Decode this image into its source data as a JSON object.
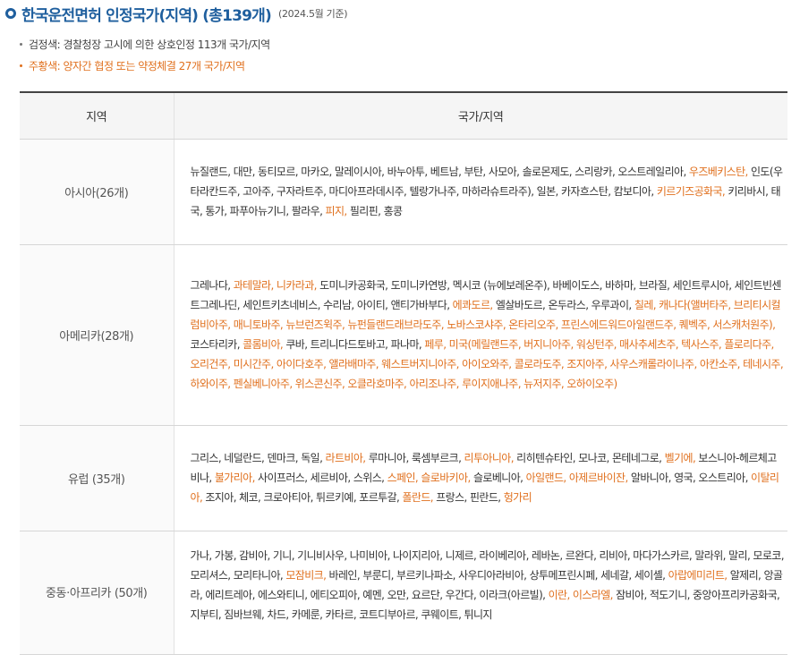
{
  "header": {
    "title": "한국운전면허 인정국가(지역) (총139개)",
    "note": "(2024.5월 기준)"
  },
  "notes": [
    {
      "text": "검정색: 경찰청장 고시에 의한 상호인정 113개 국가/지역",
      "color": "#444444"
    },
    {
      "text": "주황색: 양자간 협정 또는 약정체결 27개 국가/지역",
      "color": "#e0701e"
    }
  ],
  "colors": {
    "title": "#1f5f9e",
    "highlight": "#e0701e"
  },
  "table": {
    "headers": [
      "지역",
      "국가/지역"
    ],
    "rows": [
      {
        "region": "아시아(26개)",
        "countries": [
          {
            "text": "뉴질랜드, 대만, 동티모르, 마카오, 말레이시아, 바누아투, 베트남, 부탄, 사모아, 솔로몬제도, 스리랑카, 오스트레일리아, ",
            "highlight": false
          },
          {
            "text": "우즈베키스탄,",
            "highlight": true
          },
          {
            "text": " 인도(우타라칸드주, 고아주, 구자라트주, 마디아프라데시주, 텔랑가나주, 마하라슈트라주), 일본, 카자흐스탄, 캄보디아, ",
            "highlight": false
          },
          {
            "text": "키르기즈공화국,",
            "highlight": true
          },
          {
            "text": " 키리바시, 태국, 통가, 파푸아뉴기니, 팔라우, ",
            "highlight": false
          },
          {
            "text": "피지,",
            "highlight": true
          },
          {
            "text": " 필리핀, 홍콩",
            "highlight": false
          }
        ]
      },
      {
        "region": "아메리카(28개)",
        "countries": [
          {
            "text": "그레나다, ",
            "highlight": false
          },
          {
            "text": "과테말라, 니카라과,",
            "highlight": true
          },
          {
            "text": " 도미니카공화국, 도미니카연방, 멕시코 (뉴에보레온주), 바베이도스, 바하마, 브라질, 세인트루시아, 세인트빈센트그레나딘, 세인트키츠네비스, 수리남, 아이티, 앤티가바부다, ",
            "highlight": false
          },
          {
            "text": "에콰도르,",
            "highlight": true
          },
          {
            "text": " 엘살바도르, 온두라스, 우루과이, ",
            "highlight": false
          },
          {
            "text": "칠레, 캐나다(앨버타주, 브리티시컬럼비아주, 매니토바주, 뉴브런즈윅주, 뉴펀들랜드래브라도주, 노바스코샤주, 온타리오주, 프린스에드워드아일랜드주, 퀘벡주, 서스캐처원주),",
            "highlight": true
          },
          {
            "text": " 코스타리카, ",
            "highlight": false
          },
          {
            "text": "콜롬비아,",
            "highlight": true
          },
          {
            "text": " 쿠바, 트리니다드토바고, 파나마, ",
            "highlight": false
          },
          {
            "text": "페루, 미국(메릴랜드주, 버지니아주, 워싱턴주, 매사추세츠주, 텍사스주, 플로리다주, 오리건주, 미시간주, 아이다호주, 앨라배마주, 웨스트버지니아주, 아이오와주, 콜로라도주, 조지아주, 사우스캐롤라이나주, 아칸소주, 테네시주, 하와이주, 펜실베니아주, 위스콘신주, 오클라호마주, 아리조나주, 루이지애나주, 뉴저지주, 오하이오주)",
            "highlight": true
          }
        ]
      },
      {
        "region": "유럽 (35개)",
        "countries": [
          {
            "text": "그리스, 네덜란드, 덴마크, 독일, ",
            "highlight": false
          },
          {
            "text": "라트비아,",
            "highlight": true
          },
          {
            "text": " 루마니아, 룩셈부르크, ",
            "highlight": false
          },
          {
            "text": "리투아니아,",
            "highlight": true
          },
          {
            "text": " 리히텐슈타인, 모나코, 몬테네그로, ",
            "highlight": false
          },
          {
            "text": "벨기에,",
            "highlight": true
          },
          {
            "text": " 보스니아-헤르체고비나, ",
            "highlight": false
          },
          {
            "text": "불가리아,",
            "highlight": true
          },
          {
            "text": " 사이프러스, 세르비아, 스위스, ",
            "highlight": false
          },
          {
            "text": "스페인, 슬로바키아,",
            "highlight": true
          },
          {
            "text": " 슬로베니아, ",
            "highlight": false
          },
          {
            "text": "아일랜드, 아제르바이잔,",
            "highlight": true
          },
          {
            "text": " 알바니아, 영국, 오스트리아, ",
            "highlight": false
          },
          {
            "text": "이탈리아,",
            "highlight": true
          },
          {
            "text": " 조지아, 체코, 크로아티아, 튀르키예, 포르투갈, ",
            "highlight": false
          },
          {
            "text": "폴란드,",
            "highlight": true
          },
          {
            "text": " 프랑스, 핀란드, ",
            "highlight": false
          },
          {
            "text": "헝가리",
            "highlight": true
          }
        ]
      },
      {
        "region": "중동·아프리카 (50개)",
        "countries": [
          {
            "text": "가나, 가봉, 감비아, 기니, 기니비사우, 나미비아, 나이지리아, 니제르, 라이베리아, 레바논, 르완다, 리비아, 마다가스카르, 말라위, 말리, 모로코, 모리셔스, 모리타니아, ",
            "highlight": false
          },
          {
            "text": "모잠비크,",
            "highlight": true
          },
          {
            "text": " 바레인, 부룬디, 부르키나파소, 사우디아라비아, 상투메프린시페, 세네갈, 세이셸, ",
            "highlight": false
          },
          {
            "text": "아랍에미리트,",
            "highlight": true
          },
          {
            "text": " 알제리, 앙골라, 에리트레아, 에스와티니, 에티오피아, 예멘, 오만, 요르단, 우간다, 이라크(아르빌), ",
            "highlight": false
          },
          {
            "text": "이란, 이스라엘,",
            "highlight": true
          },
          {
            "text": " 잠비아, 적도기니, 중앙아프리카공화국, 지부티, 짐바브웨, 차드, 카메룬, 카타르, 코트디부아르, 쿠웨이트, 튀니지",
            "highlight": false
          }
        ]
      }
    ]
  }
}
